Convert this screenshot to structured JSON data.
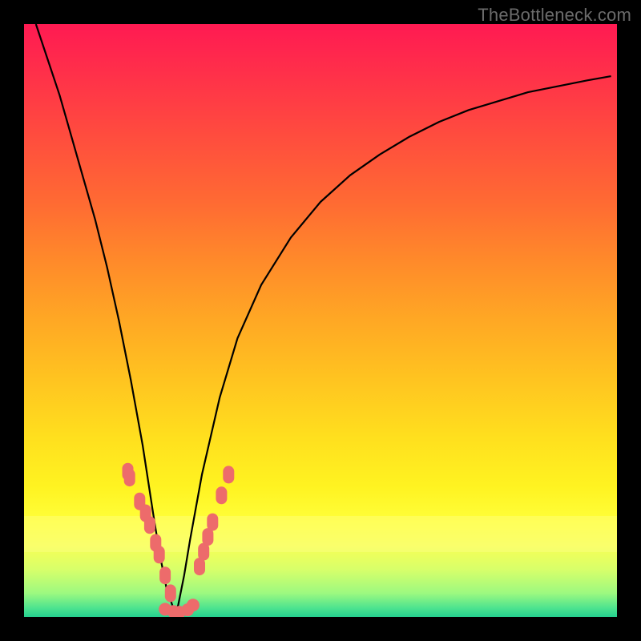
{
  "watermark": "TheBottleneck.com",
  "chart_data": {
    "type": "line",
    "title": "",
    "xlabel": "",
    "ylabel": "",
    "xlim": [
      0,
      1
    ],
    "ylim": [
      0,
      1
    ],
    "grid": false,
    "legend": false,
    "background_gradient": {
      "direction": "vertical",
      "stops": [
        {
          "pos": 0.0,
          "color": "#ff1a52"
        },
        {
          "pos": 0.5,
          "color": "#ffa824"
        },
        {
          "pos": 0.84,
          "color": "#ffff3a"
        },
        {
          "pos": 1.0,
          "color": "#25d08f"
        }
      ]
    },
    "series": [
      {
        "name": "curve",
        "color": "#000000",
        "stroke_width": 2,
        "x": [
          0.02,
          0.04,
          0.06,
          0.08,
          0.1,
          0.12,
          0.14,
          0.16,
          0.18,
          0.2,
          0.22,
          0.23,
          0.24,
          0.25,
          0.255,
          0.26,
          0.27,
          0.28,
          0.3,
          0.33,
          0.36,
          0.4,
          0.45,
          0.5,
          0.55,
          0.6,
          0.65,
          0.7,
          0.75,
          0.8,
          0.85,
          0.9,
          0.95,
          0.99
        ],
        "y": [
          1.0,
          0.94,
          0.88,
          0.81,
          0.74,
          0.67,
          0.59,
          0.5,
          0.4,
          0.29,
          0.16,
          0.1,
          0.05,
          0.02,
          0.005,
          0.02,
          0.07,
          0.13,
          0.24,
          0.37,
          0.47,
          0.56,
          0.64,
          0.7,
          0.745,
          0.78,
          0.81,
          0.835,
          0.855,
          0.87,
          0.885,
          0.895,
          0.905,
          0.912
        ]
      }
    ],
    "markers": [
      {
        "name": "left-dots",
        "color": "#ed6b6b",
        "shape": "rounded-rect",
        "x": [
          0.175,
          0.178,
          0.195,
          0.205,
          0.212,
          0.222,
          0.228,
          0.238,
          0.247
        ],
        "y": [
          0.245,
          0.235,
          0.195,
          0.175,
          0.155,
          0.125,
          0.105,
          0.07,
          0.04
        ]
      },
      {
        "name": "bottom-dots",
        "color": "#ed6b6b",
        "shape": "circle",
        "x": [
          0.238,
          0.252,
          0.262,
          0.276,
          0.285
        ],
        "y": [
          0.013,
          0.009,
          0.008,
          0.012,
          0.02
        ]
      },
      {
        "name": "right-dots",
        "color": "#ed6b6b",
        "shape": "rounded-rect",
        "x": [
          0.296,
          0.303,
          0.31,
          0.318,
          0.333,
          0.345
        ],
        "y": [
          0.085,
          0.11,
          0.135,
          0.16,
          0.205,
          0.24
        ]
      }
    ],
    "highlight_bands": [
      {
        "y0": 0.84,
        "y1": 0.9,
        "color": "rgba(255,255,150,0.35)"
      }
    ]
  }
}
